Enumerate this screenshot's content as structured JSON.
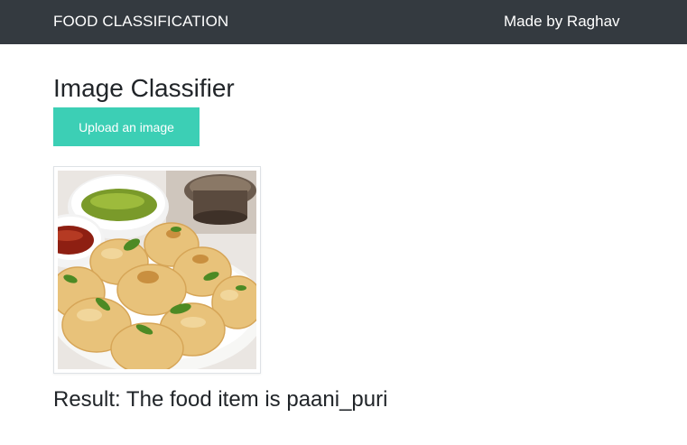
{
  "navbar": {
    "brand": "FOOD CLASSIFICATION",
    "author": "Made by Raghav",
    "background_color": "#343a40"
  },
  "main": {
    "title": "Image Classifier",
    "upload_button_label": "Upload an image",
    "upload_button_color": "#3ccfb5",
    "uploaded_image": {
      "description_icon": "food-photo"
    },
    "result_text": "Result: The food item is paani_puri"
  }
}
